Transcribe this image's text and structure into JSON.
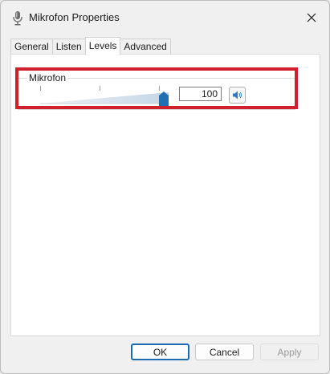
{
  "window": {
    "title": "Mikrofon Properties",
    "icon": "microphone-icon",
    "close_icon": "close-icon"
  },
  "tabs": [
    {
      "label": "General",
      "active": false
    },
    {
      "label": "Listen",
      "active": false
    },
    {
      "label": "Levels",
      "active": true
    },
    {
      "label": "Advanced",
      "active": false
    }
  ],
  "levels": {
    "group_label": "Mikrofon",
    "slider_value": 100,
    "slider_max": 100,
    "input_value": "100",
    "mute_button_icon": "speaker-icon",
    "highlight_color": "#d0202c"
  },
  "buttons": {
    "ok": "OK",
    "cancel": "Cancel",
    "apply": "Apply",
    "apply_enabled": false
  },
  "colors": {
    "accent": "#1c6ab6",
    "slider_thumb": "#1f6fb2"
  }
}
